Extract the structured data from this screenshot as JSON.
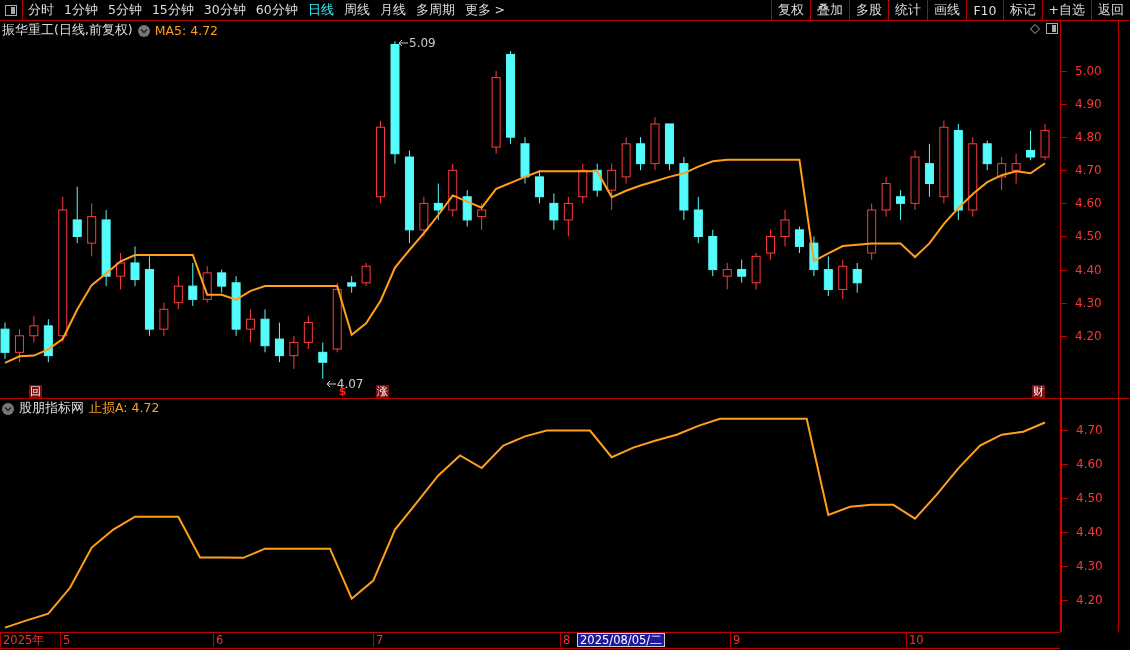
{
  "toolbar": {
    "periods": [
      {
        "label": "分时",
        "selected": false
      },
      {
        "label": "1分钟",
        "selected": false
      },
      {
        "label": "5分钟",
        "selected": false
      },
      {
        "label": "15分钟",
        "selected": false
      },
      {
        "label": "30分钟",
        "selected": false
      },
      {
        "label": "60分钟",
        "selected": false
      },
      {
        "label": "日线",
        "selected": true
      },
      {
        "label": "周线",
        "selected": false
      },
      {
        "label": "月线",
        "selected": false
      },
      {
        "label": "多周期",
        "selected": false
      },
      {
        "label": "更多 >",
        "selected": false
      }
    ],
    "buttons": [
      "复权",
      "叠加",
      "多股",
      "统计",
      "画线",
      "F10",
      "标记",
      "+自选",
      "返回"
    ]
  },
  "price_panel": {
    "title": "振华重工(日线,前复权)",
    "indicator": "MA5: 4.72",
    "chart_data": {
      "type": "candlestick",
      "categories": [
        null,
        null,
        null,
        null,
        null,
        null,
        null,
        null,
        null,
        null,
        null,
        null,
        null,
        null,
        null,
        null,
        null,
        null,
        null,
        null,
        null,
        null,
        null,
        null,
        null,
        null,
        null,
        null,
        null,
        null,
        null,
        null,
        null,
        null,
        null,
        null,
        null,
        null,
        null,
        null,
        null,
        null,
        null,
        null,
        null,
        null,
        null,
        null,
        null,
        null,
        null,
        null,
        null,
        null,
        null,
        null,
        null,
        null,
        null,
        null,
        null,
        null,
        null,
        null,
        null,
        null,
        null,
        null,
        null,
        null,
        null,
        null,
        null
      ],
      "ohlc": [
        [
          4.22,
          4.24,
          4.13,
          4.15
        ],
        [
          4.15,
          4.22,
          4.12,
          4.2
        ],
        [
          4.2,
          4.26,
          4.18,
          4.23
        ],
        [
          4.23,
          4.25,
          4.12,
          4.14
        ],
        [
          4.2,
          4.62,
          4.18,
          4.58
        ],
        [
          4.55,
          4.65,
          4.48,
          4.5
        ],
        [
          4.48,
          4.6,
          4.44,
          4.56
        ],
        [
          4.55,
          4.58,
          4.35,
          4.38
        ],
        [
          4.38,
          4.45,
          4.34,
          4.42
        ],
        [
          4.42,
          4.47,
          4.35,
          4.37
        ],
        [
          4.4,
          4.44,
          4.2,
          4.22
        ],
        [
          4.22,
          4.3,
          4.2,
          4.28
        ],
        [
          4.3,
          4.38,
          4.28,
          4.35
        ],
        [
          4.35,
          4.42,
          4.29,
          4.31
        ],
        [
          4.31,
          4.41,
          4.3,
          4.39
        ],
        [
          4.39,
          4.4,
          4.33,
          4.35
        ],
        [
          4.36,
          4.38,
          4.2,
          4.22
        ],
        [
          4.22,
          4.28,
          4.18,
          4.25
        ],
        [
          4.25,
          4.28,
          4.15,
          4.17
        ],
        [
          4.19,
          4.24,
          4.12,
          4.14
        ],
        [
          4.14,
          4.2,
          4.1,
          4.18
        ],
        [
          4.18,
          4.26,
          4.16,
          4.24
        ],
        [
          4.15,
          4.18,
          4.07,
          4.12
        ],
        [
          4.16,
          4.36,
          4.15,
          4.34
        ],
        [
          4.36,
          4.38,
          4.33,
          4.35
        ],
        [
          4.36,
          4.42,
          4.35,
          4.41
        ],
        [
          4.62,
          4.85,
          4.6,
          4.83
        ],
        [
          5.08,
          5.09,
          4.72,
          4.75
        ],
        [
          4.74,
          4.76,
          4.48,
          4.52
        ],
        [
          4.52,
          4.62,
          4.5,
          4.6
        ],
        [
          4.6,
          4.66,
          4.55,
          4.58
        ],
        [
          4.58,
          4.72,
          4.56,
          4.7
        ],
        [
          4.62,
          4.64,
          4.53,
          4.55
        ],
        [
          4.56,
          4.6,
          4.52,
          4.58
        ],
        [
          4.77,
          5.0,
          4.75,
          4.98
        ],
        [
          5.05,
          5.06,
          4.78,
          4.8
        ],
        [
          4.78,
          4.8,
          4.66,
          4.68
        ],
        [
          4.68,
          4.7,
          4.6,
          4.62
        ],
        [
          4.6,
          4.63,
          4.52,
          4.55
        ],
        [
          4.55,
          4.62,
          4.5,
          4.6
        ],
        [
          4.62,
          4.72,
          4.6,
          4.7
        ],
        [
          4.7,
          4.72,
          4.62,
          4.64
        ],
        [
          4.64,
          4.72,
          4.58,
          4.7
        ],
        [
          4.68,
          4.8,
          4.66,
          4.78
        ],
        [
          4.78,
          4.8,
          4.7,
          4.72
        ],
        [
          4.72,
          4.86,
          4.7,
          4.84
        ],
        [
          4.84,
          4.84,
          4.7,
          4.72
        ],
        [
          4.72,
          4.74,
          4.55,
          4.58
        ],
        [
          4.58,
          4.62,
          4.48,
          4.5
        ],
        [
          4.5,
          4.52,
          4.38,
          4.4
        ],
        [
          4.38,
          4.42,
          4.34,
          4.4
        ],
        [
          4.4,
          4.43,
          4.36,
          4.38
        ],
        [
          4.36,
          4.45,
          4.34,
          4.44
        ],
        [
          4.45,
          4.52,
          4.43,
          4.5
        ],
        [
          4.5,
          4.58,
          4.47,
          4.55
        ],
        [
          4.52,
          4.53,
          4.45,
          4.47
        ],
        [
          4.48,
          4.5,
          4.38,
          4.4
        ],
        [
          4.4,
          4.44,
          4.32,
          4.34
        ],
        [
          4.34,
          4.43,
          4.31,
          4.41
        ],
        [
          4.4,
          4.42,
          4.33,
          4.36
        ],
        [
          4.45,
          4.6,
          4.43,
          4.58
        ],
        [
          4.58,
          4.68,
          4.56,
          4.66
        ],
        [
          4.62,
          4.64,
          4.55,
          4.6
        ],
        [
          4.6,
          4.76,
          4.58,
          4.74
        ],
        [
          4.72,
          4.78,
          4.62,
          4.66
        ],
        [
          4.62,
          4.85,
          4.6,
          4.83
        ],
        [
          4.82,
          4.84,
          4.55,
          4.58
        ],
        [
          4.58,
          4.8,
          4.56,
          4.78
        ],
        [
          4.78,
          4.79,
          4.7,
          4.72
        ],
        [
          4.68,
          4.74,
          4.64,
          4.72
        ],
        [
          4.7,
          4.75,
          4.66,
          4.72
        ],
        [
          4.76,
          4.82,
          4.73,
          4.74
        ],
        [
          4.74,
          4.84,
          4.73,
          4.82
        ]
      ],
      "series": [
        {
          "type": "line",
          "color": "#ff9f1a",
          "values": [
            4.118,
            4.138,
            4.14,
            4.159,
            4.191,
            4.279,
            4.353,
            4.388,
            4.425,
            4.444,
            4.444,
            4.444,
            4.444,
            4.444,
            4.324,
            4.324,
            4.309,
            4.336,
            4.35,
            4.35,
            4.35,
            4.35,
            4.35,
            4.35,
            4.203,
            4.238,
            4.306,
            4.406,
            4.459,
            4.51,
            4.565,
            4.624,
            4.605,
            4.587,
            4.644,
            4.662,
            4.68,
            4.697,
            4.697,
            4.697,
            4.697,
            4.697,
            4.619,
            4.638,
            4.654,
            4.667,
            4.68,
            4.691,
            4.711,
            4.727,
            4.732,
            4.732,
            4.732,
            4.732,
            4.732,
            4.732,
            4.426,
            4.449,
            4.471,
            4.475,
            4.479,
            4.479,
            4.479,
            4.438,
            4.479,
            4.538,
            4.586,
            4.628,
            4.664,
            4.685,
            4.697,
            4.691,
            4.721
          ]
        }
      ],
      "ylim": [
        4.012,
        5.151
      ],
      "yticks": [
        {
          "value": 5.0,
          "label": "5.00"
        },
        {
          "value": 4.9,
          "label": "4.90"
        },
        {
          "value": 4.8,
          "label": "4.80"
        },
        {
          "value": 4.7,
          "label": "4.70"
        },
        {
          "value": 4.6,
          "label": "4.60"
        },
        {
          "value": 4.5,
          "label": "4.50"
        },
        {
          "value": 4.4,
          "label": "4.40"
        },
        {
          "value": 4.3,
          "label": "4.30"
        },
        {
          "value": 4.2,
          "label": "4.20"
        }
      ]
    },
    "high_label": "5.09",
    "low_label": "4.07",
    "markers": [
      {
        "kind": "box",
        "text": "回"
      },
      {
        "kind": "dollar",
        "text": "$"
      },
      {
        "kind": "box",
        "text": "涨"
      },
      {
        "kind": "box",
        "text": "财"
      }
    ]
  },
  "indicator_panel": {
    "title": "股朋指标网",
    "indicator": "止损A: 4.72",
    "chart_data": {
      "type": "line",
      "categories": [
        null,
        null,
        null,
        null,
        null,
        null,
        null,
        null,
        null,
        null,
        null,
        null,
        null,
        null,
        null,
        null,
        null,
        null,
        null,
        null,
        null,
        null,
        null,
        null,
        null,
        null,
        null,
        null,
        null,
        null,
        null,
        null,
        null,
        null,
        null,
        null,
        null,
        null,
        null,
        null,
        null,
        null,
        null,
        null,
        null,
        null,
        null,
        null,
        null
      ],
      "series": [
        {
          "color": "#ff9f1a",
          "values": [
            4.118,
            4.139,
            4.159,
            4.235,
            4.353,
            4.406,
            4.444,
            4.444,
            4.444,
            4.324,
            4.324,
            4.323,
            4.35,
            4.35,
            4.35,
            4.35,
            4.203,
            4.256,
            4.406,
            4.485,
            4.565,
            4.624,
            4.587,
            4.653,
            4.68,
            4.697,
            4.697,
            4.697,
            4.619,
            4.647,
            4.667,
            4.685,
            4.711,
            4.732,
            4.732,
            4.732,
            4.732,
            4.732,
            4.449,
            4.473,
            4.479,
            4.479,
            4.438,
            4.509,
            4.586,
            4.653,
            4.685,
            4.694,
            4.721
          ]
        }
      ],
      "ylim": [
        4.105,
        4.79
      ],
      "yticks": [
        {
          "value": 4.7,
          "label": "4.70"
        },
        {
          "value": 4.6,
          "label": "4.60"
        },
        {
          "value": 4.5,
          "label": "4.50"
        },
        {
          "value": 4.4,
          "label": "4.40"
        },
        {
          "value": 4.3,
          "label": "4.30"
        },
        {
          "value": 4.2,
          "label": "4.20"
        }
      ]
    }
  },
  "time_axis": {
    "labels": [
      "2025年",
      "5",
      "6",
      "7",
      "8",
      "9",
      "10"
    ],
    "cursor_date": "2025/08/05/二"
  }
}
